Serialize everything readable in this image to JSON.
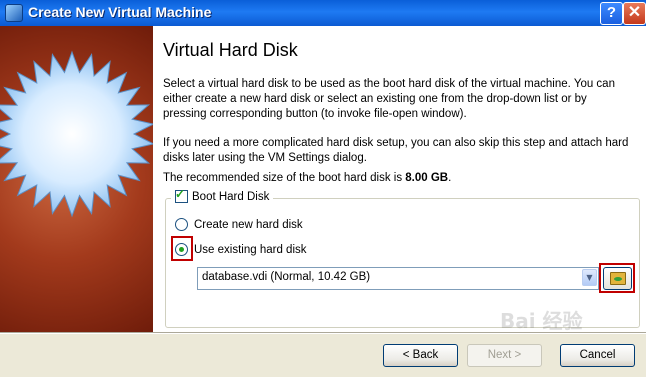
{
  "window": {
    "title": "Create New Virtual Machine",
    "help_label": "?",
    "close_label": "✕"
  },
  "page": {
    "title": "Virtual Hard Disk",
    "para1": "Select a virtual hard disk to be used as the boot hard disk of the virtual machine. You can either create a new hard disk or select an existing one from the drop-down list or by pressing corresponding button (to invoke file-open window).",
    "para2": "If you need a more complicated hard disk setup, you can also skip this step and attach hard disks later using the VM Settings dialog.",
    "recommended_prefix": "The recommended size of the boot hard disk is ",
    "recommended_size": "8.00 GB",
    "recommended_suffix": "."
  },
  "boot_disk": {
    "label": "Boot Hard Disk",
    "checked": true,
    "options": [
      {
        "label": "Create new hard disk",
        "selected": false
      },
      {
        "label": "Use existing hard disk",
        "selected": true
      }
    ],
    "selected_disk": "database.vdi (Normal, 10.42 GB)"
  },
  "buttons": {
    "back": "< Back",
    "next": "Next >",
    "cancel": "Cancel"
  },
  "watermark": "Bai 经验",
  "icons": [
    "app-icon",
    "help-icon",
    "close-icon",
    "checkbox-checked-icon",
    "radio-icon",
    "dropdown-arrow-icon",
    "folder-open-icon"
  ],
  "colors": {
    "titlebar": "#0a5fd8",
    "highlight": "#c00000",
    "sidebar": "#a33a1c"
  }
}
